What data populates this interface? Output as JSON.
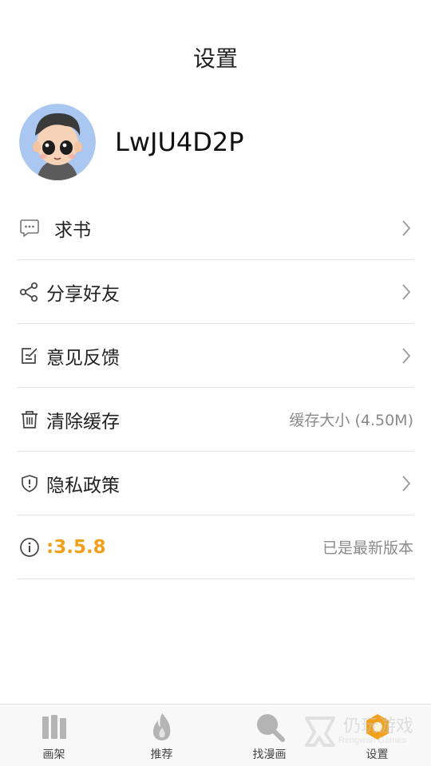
{
  "header": {
    "title": "设置"
  },
  "profile": {
    "username": "LwJU4D2P"
  },
  "menu": {
    "items": [
      {
        "label": "求书",
        "icon": "chat-bubble-icon"
      },
      {
        "label": "分享好友",
        "icon": "share-icon"
      },
      {
        "label": "意见反馈",
        "icon": "edit-note-icon"
      },
      {
        "label": "清除缓存",
        "icon": "trash-icon",
        "right_text": "缓存大小 (4.50M)"
      },
      {
        "label": "隐私政策",
        "icon": "shield-icon"
      }
    ],
    "version": {
      "label": ":3.5.8",
      "right_text": "已是最新版本",
      "icon": "info-icon"
    }
  },
  "tabs": [
    {
      "label": "画架",
      "icon": "bookshelf-icon"
    },
    {
      "label": "推荐",
      "icon": "flame-icon"
    },
    {
      "label": "找漫画",
      "icon": "search-icon"
    },
    {
      "label": "设置",
      "icon": "settings-hex-icon",
      "active": true
    }
  ],
  "watermark": {
    "text": "仍玩游戏",
    "sub": "Rengwan Games"
  },
  "colors": {
    "accent": "#f2a01a",
    "divider": "#e6e6e6",
    "muted": "#8a8a8a"
  }
}
